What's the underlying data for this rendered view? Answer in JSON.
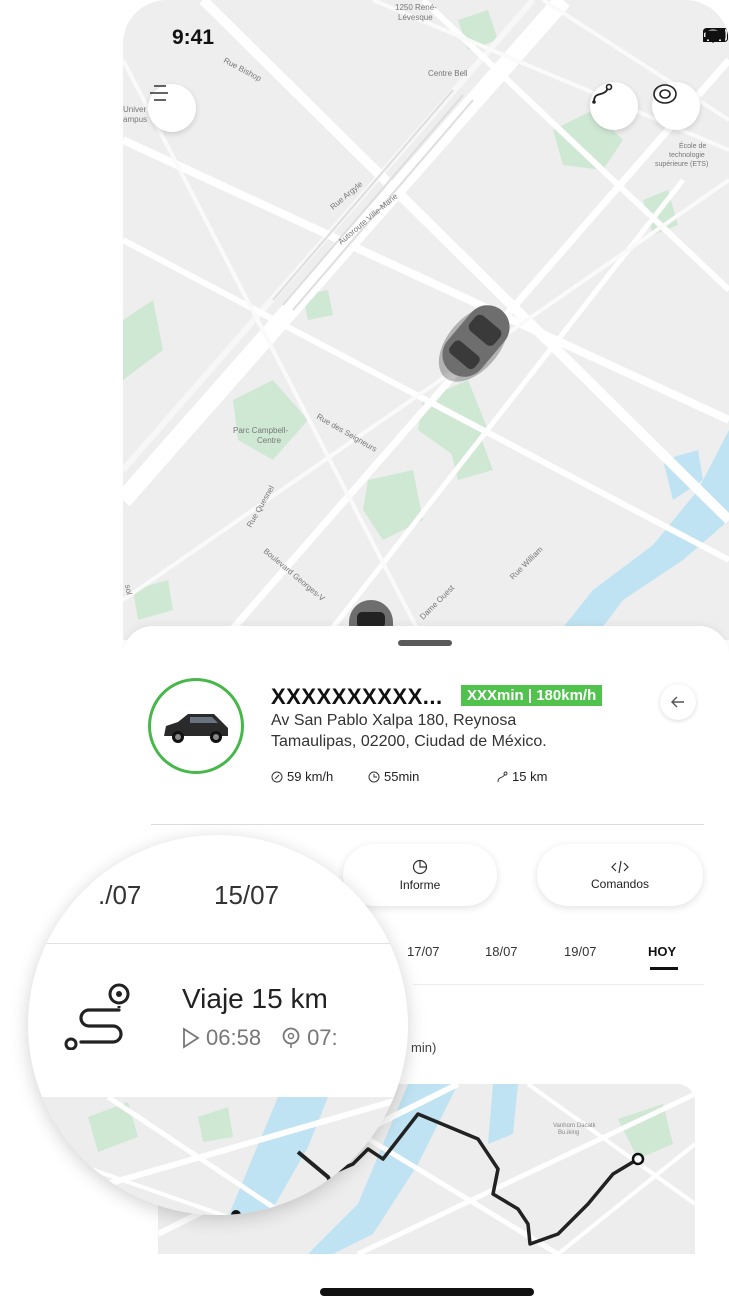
{
  "status_bar": {
    "time": "9:41"
  },
  "map": {
    "labels": {
      "rene_levesque": "1250 René-\nLévesque",
      "centre_bell": "Centre Bell",
      "bishop": "Rue Bishop",
      "univer": "Univer\nampus",
      "ecole": "École de\ntechnologie\nsupérieure (ETS)",
      "argyle": "Rue Argyle",
      "ville_marie": "Autoroute Ville-Marie",
      "parc_campbell": "Parc Campbell-\nCentre",
      "seigneurs": "Rue des Seigneurs",
      "quesnel": "Rue Quesnel",
      "georges": "Boulevard Georges-V",
      "dame_ouest": "Dame Ouest",
      "william": "Rue William",
      "sol": "sol"
    }
  },
  "vehicle": {
    "name": "XXXXXXXXXX...",
    "badge": "XXXmin | 180km/h",
    "address_line1": "Av San Pablo Xalpa 180, Reynosa",
    "address_line2": "Tamaulipas, 02200, Ciudad de México.",
    "speed": "59 km/h",
    "duration": "55min",
    "distance": "15 km"
  },
  "actions": {
    "informe": "Informe",
    "comandos": "Comandos"
  },
  "dates": {
    "d17": "17/07",
    "d18": "18/07",
    "d19": "19/07",
    "today": "HOY"
  },
  "trip": {
    "dur_fragment": "min)"
  },
  "trip_map": {
    "labels": {
      "vanhorn": "Vanhorn Dacatk\nBu.iking"
    }
  },
  "magnifier": {
    "date_left": "./07",
    "date_mid": "15/07",
    "trip_title": "Viaje 15 km",
    "start_time": "06:58",
    "end_time": "07:"
  },
  "colors": {
    "accent_green": "#52c24f",
    "ring_green": "#46b84a",
    "water": "#bfe3f2",
    "park": "#cfe8d4"
  }
}
